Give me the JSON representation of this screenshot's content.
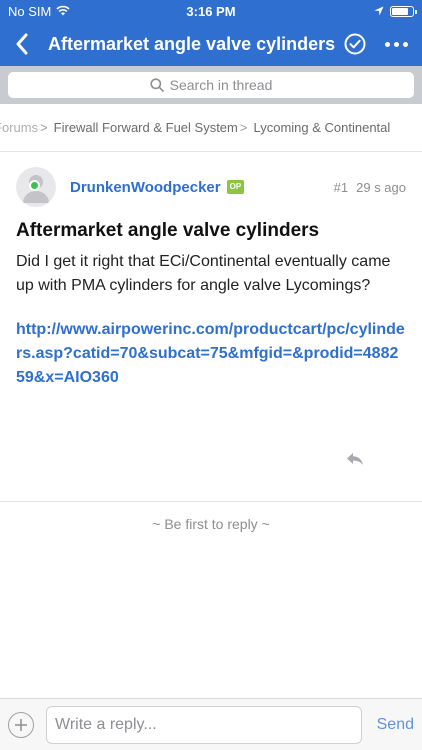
{
  "status_bar": {
    "carrier": "No SIM",
    "time": "3:16 PM",
    "battery_level": 0.8
  },
  "nav": {
    "title": "Aftermarket angle valve cylinders",
    "icons": [
      "back-chevron-icon",
      "check-circle-icon",
      "more-dots-icon"
    ]
  },
  "search": {
    "placeholder": "Search in thread"
  },
  "breadcrumb": {
    "items": [
      "Forums",
      "Firewall Forward & Fuel System",
      "Lycoming & Continental"
    ]
  },
  "post": {
    "author": "DrunkenWoodpecker",
    "badge": "OP",
    "number": "#1",
    "time": "29 s ago",
    "title": "Aftermarket angle valve cylinders",
    "body": "Did I get it right that ECi/Continental eventually came up with PMA cylinders for angle valve Lycomings?",
    "link": "http://www.airpowerinc.com/productcart/pc/cylinders.asp?catid=70&subcat=75&mfgid=&prodid=488259&x=AIO360"
  },
  "empty_state": "~ Be first to reply ~",
  "composer": {
    "placeholder": "Write a reply...",
    "send_label": "Send"
  },
  "colors": {
    "accent": "#2f6fd0",
    "online": "#3ac44a",
    "op_badge": "#8cc63f"
  }
}
